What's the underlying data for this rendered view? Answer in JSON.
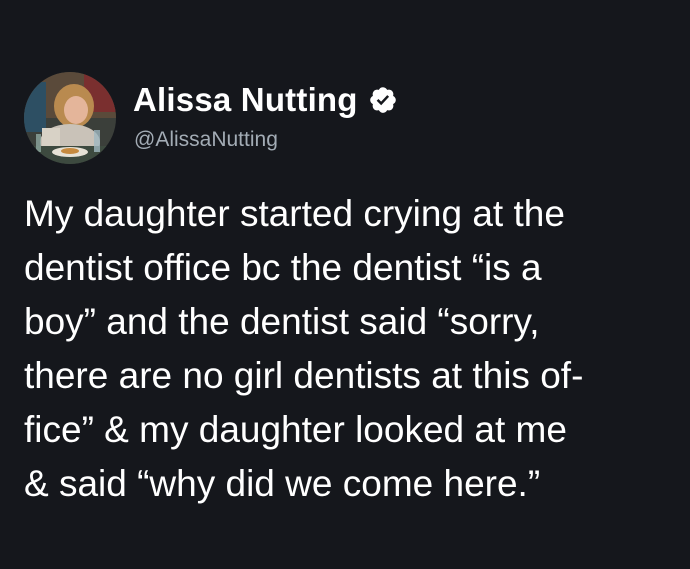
{
  "author": {
    "display_name": "Alissa Nutting",
    "handle": "@AlissaNutting",
    "verified_icon": "verified-badge-icon",
    "avatar_icon": "profile-photo"
  },
  "tweet": {
    "lines": [
      "My daughter started crying at the",
      "dentist office bc the dentist “is a",
      "boy” and the dentist said “sorry,",
      "there are no girl dentists at this of-",
      "fice” & my daughter looked at me",
      "& said “why did we come here.”"
    ]
  },
  "colors": {
    "background": "#15171c",
    "text": "#ffffff",
    "handle": "#a3acb5"
  }
}
